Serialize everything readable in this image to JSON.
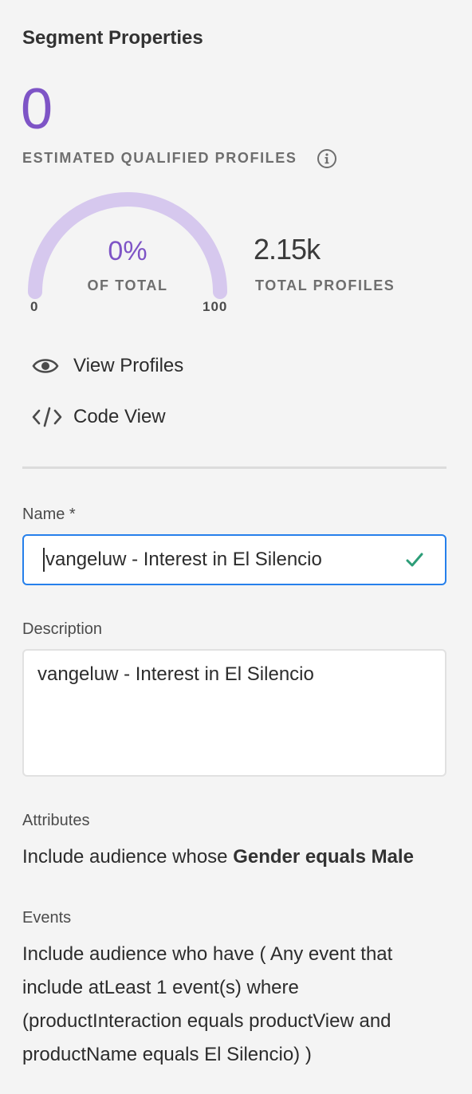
{
  "panel": {
    "title": "Segment Properties",
    "estimated_count": "0",
    "estimated_label": "ESTIMATED QUALIFIED PROFILES",
    "info_icon": "info-icon"
  },
  "gauge": {
    "percent_text": "0%",
    "percent_value": 0,
    "of_total_label": "OF TOTAL",
    "min_label": "0",
    "max_label": "100",
    "track_color": "#d6c8ee",
    "fill_color": "#7e54c6"
  },
  "totals": {
    "value": "2.15k",
    "label": "TOTAL PROFILES"
  },
  "actions": {
    "view_profiles": {
      "label": "View Profiles",
      "icon": "eye-icon"
    },
    "code_view": {
      "label": "Code View",
      "icon": "code-icon"
    }
  },
  "form": {
    "name_label": "Name *",
    "name_value": "vangeluw - Interest in El Silencio",
    "name_valid_icon": "checkmark-icon",
    "description_label": "Description",
    "description_value": "vangeluw - Interest in El Silencio"
  },
  "attributes": {
    "label": "Attributes",
    "prefix": "Include audience whose ",
    "rule": "Gender equals Male"
  },
  "events": {
    "label": "Events",
    "text": "Include audience who have ( Any event that include atLeast 1 event(s) where (productInteraction equals productView and productName equals El Silencio) )"
  },
  "colors": {
    "accent": "#7e54c6",
    "focus_border": "#2680eb",
    "valid": "#2d9d78",
    "background": "#f4f4f4"
  }
}
